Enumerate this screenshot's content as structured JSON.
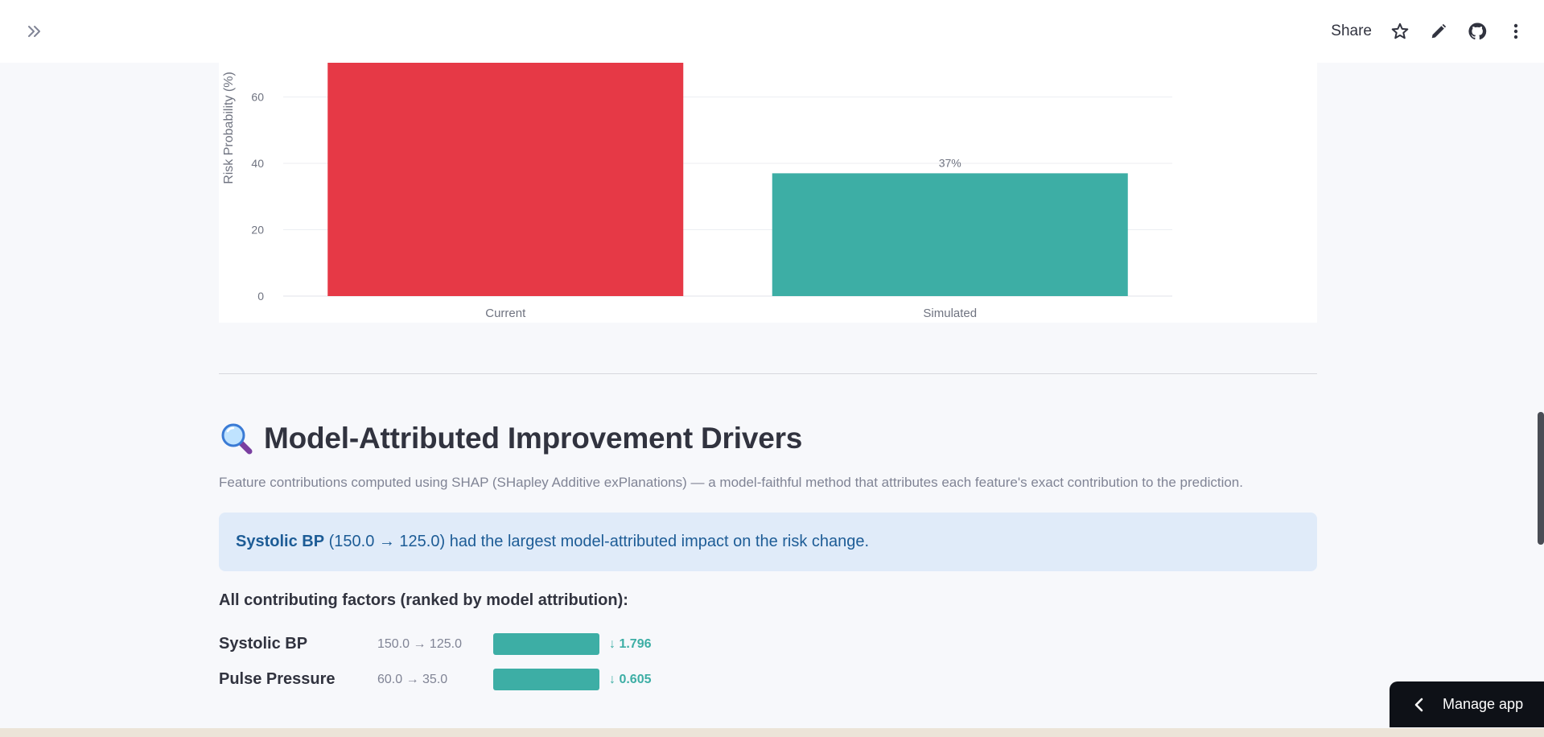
{
  "header": {
    "share_label": "Share",
    "icons": [
      "expand-sidebar-icon",
      "star-icon",
      "edit-pencil-icon",
      "github-icon",
      "more-vertical-icon"
    ]
  },
  "chart_data": {
    "type": "bar",
    "categories": [
      "Current",
      "Simulated"
    ],
    "values": [
      78,
      37
    ],
    "data_labels": [
      "",
      "37%"
    ],
    "colors": [
      "#e63946",
      "#3daea5"
    ],
    "ylabel": "Risk Probability (%)",
    "xlabel": "",
    "y_ticks": [
      0,
      20,
      40,
      60
    ],
    "ylim": [
      0,
      100
    ],
    "grid": true
  },
  "section": {
    "emoji_icon": "magnifying-glass-icon",
    "title": "Model-Attributed Improvement Drivers",
    "caption": "Feature contributions computed using SHAP (SHapley Additive exPlanations) — a model-faithful method that attributes each feature's exact contribution to the prediction."
  },
  "info": {
    "feature": "Systolic BP",
    "rest": " (150.0 → 125.0) had the largest model-attributed impact on the risk change."
  },
  "factors": {
    "heading": "All contributing factors (ranked by model attribution):",
    "items": [
      {
        "name": "Systolic BP",
        "change": "150.0 → 125.0",
        "value": "↓ 1.796",
        "magnitude": 1.0
      },
      {
        "name": "Pulse Pressure",
        "change": "60.0 → 35.0",
        "value": "↓ 0.605",
        "magnitude": 1.0
      }
    ],
    "bar_color": "#3daea5"
  },
  "manage_app": {
    "label": "Manage app"
  }
}
